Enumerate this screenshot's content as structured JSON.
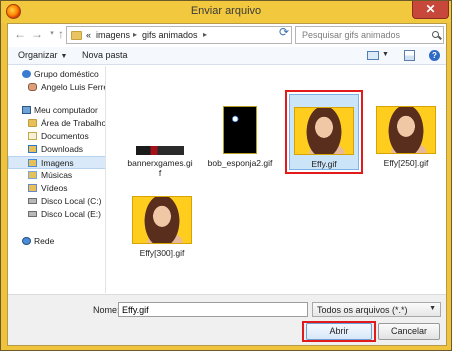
{
  "window": {
    "title": "Enviar arquivo",
    "close_label": "✕"
  },
  "address": {
    "prefix": "«",
    "crumbs": [
      "imagens",
      "gifs animados"
    ]
  },
  "search": {
    "placeholder": "Pesquisar gifs animados"
  },
  "toolbar": {
    "organize_label": "Organizar",
    "new_folder_label": "Nova pasta",
    "help_label": "?"
  },
  "nav": {
    "items": [
      {
        "label": "Grupo doméstico",
        "icon": "homegroup-icon"
      },
      {
        "label": "Angelo Luis Ferre",
        "icon": "user-icon"
      },
      {
        "label": "Meu computador",
        "icon": "computer-icon"
      },
      {
        "label": "Área de Trabalho",
        "icon": "desktop-folder-icon"
      },
      {
        "label": "Documentos",
        "icon": "documents-icon"
      },
      {
        "label": "Downloads",
        "icon": "downloads-icon"
      },
      {
        "label": "Imagens",
        "icon": "pictures-icon",
        "selected": true
      },
      {
        "label": "Músicas",
        "icon": "music-icon"
      },
      {
        "label": "Vídeos",
        "icon": "videos-icon"
      },
      {
        "label": "Disco Local (C:)",
        "icon": "disk-icon"
      },
      {
        "label": "Disco Local (E:)",
        "icon": "disk-icon"
      },
      {
        "label": "Rede",
        "icon": "network-icon"
      }
    ]
  },
  "files": [
    {
      "name": "bannerxgames.gif",
      "line1": "bannerxgames.gi",
      "line2": "f",
      "thumb": "banner"
    },
    {
      "name": "bob_esponja2.gif",
      "line1": "bob_esponja2.gif",
      "line2": "",
      "thumb": "sponge"
    },
    {
      "name": "Effy.gif",
      "line1": "Effy.gif",
      "line2": "",
      "thumb": "photo",
      "selected": true
    },
    {
      "name": "Effy[250].gif",
      "line1": "Effy[250].gif",
      "line2": "",
      "thumb": "photo"
    },
    {
      "name": "Effy[300].gif",
      "line1": "Effy[300].gif",
      "line2": "",
      "thumb": "photo"
    }
  ],
  "bottom": {
    "name_label": "Nome:",
    "name_value": "Effy.gif",
    "file_type": "Todos os arquivos (*.*)",
    "open_label": "Abrir",
    "cancel_label": "Cancelar"
  }
}
